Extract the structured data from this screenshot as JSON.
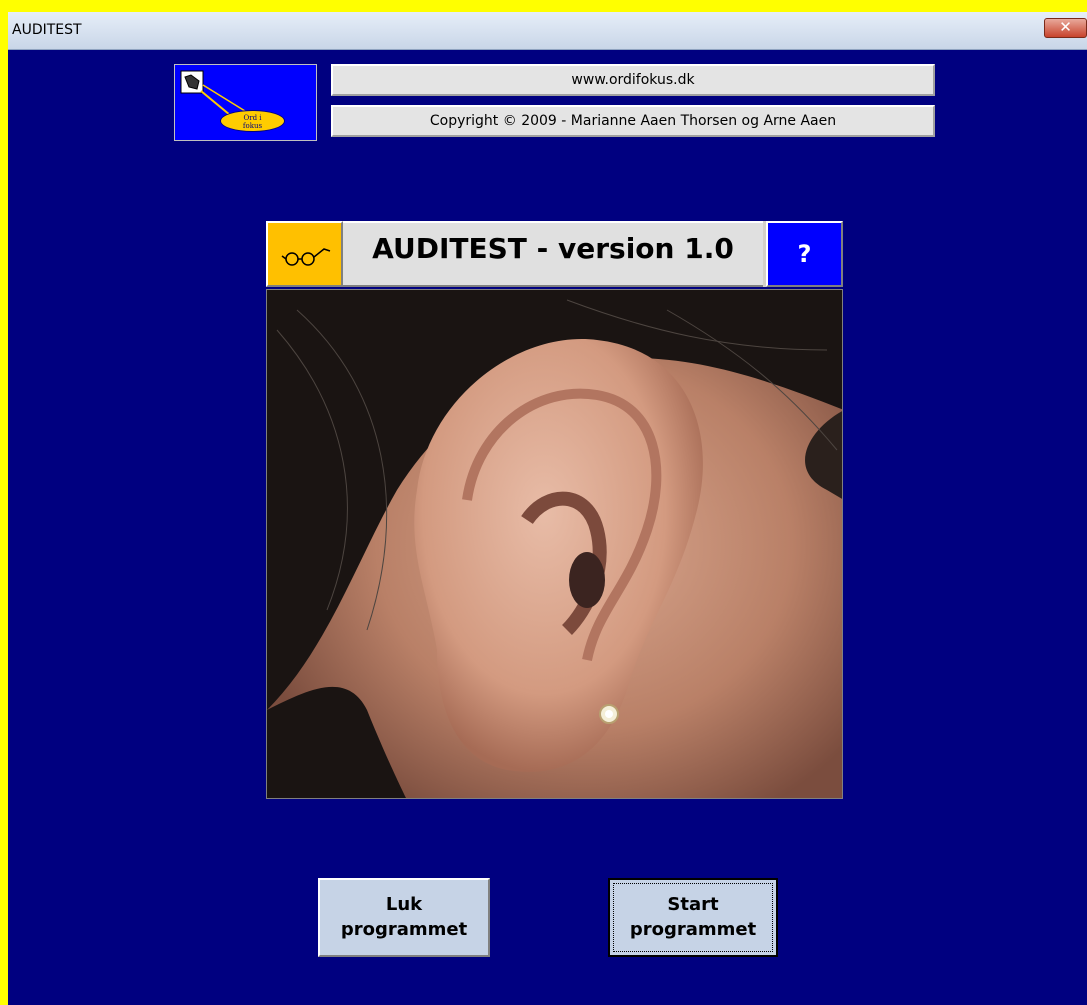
{
  "window": {
    "title": "AUDITEST",
    "close_glyph": "✕"
  },
  "header": {
    "url": "www.ordifokus.dk",
    "copyright": "Copyright © 2009 - Marianne Aaen Thorsen og Arne Aaen",
    "logo_text_line1": "Ord i",
    "logo_text_line2": "fokus"
  },
  "app": {
    "title": "AUDITEST - version 1.0",
    "help_label": "?",
    "glasses_icon": "glasses-icon"
  },
  "photo": {
    "subject": "ear"
  },
  "buttons": {
    "close_line1": "Luk",
    "close_line2": "programmet",
    "start_line1": "Start",
    "start_line2": "programmet"
  },
  "colors": {
    "background": "#000080",
    "frame": "#ffff00",
    "help_button": "#0000ff",
    "glasses_button": "#ffc000"
  }
}
